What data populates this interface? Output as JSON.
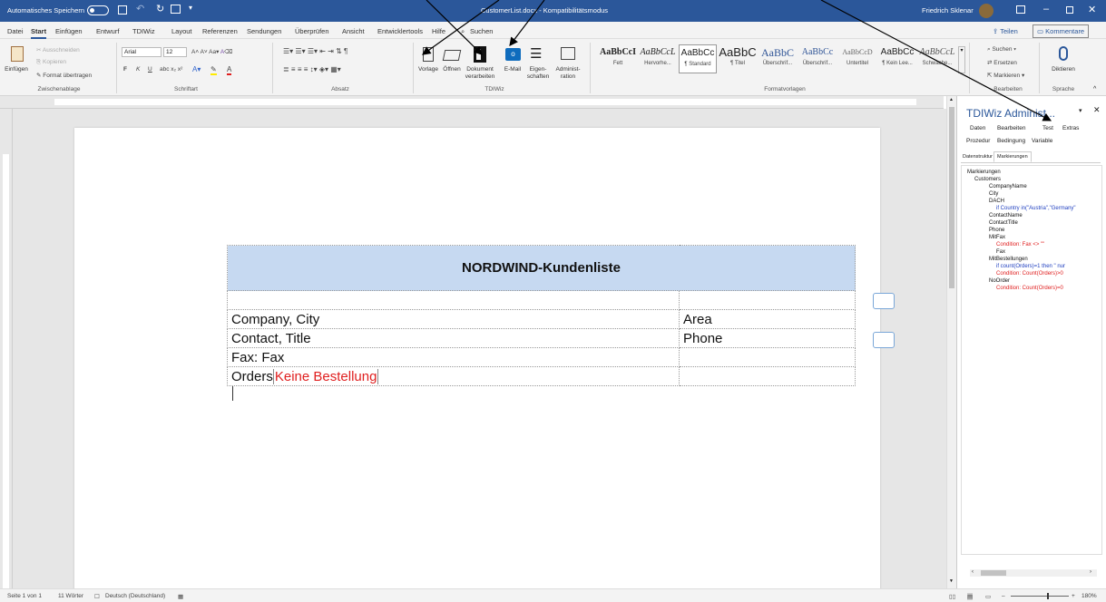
{
  "title_bar": {
    "autosave_label": "Automatisches Speichern",
    "document_title": "CustomerList.docx - Kompatibilitätsmodus",
    "search": "Suchen",
    "user": "Friedrich Sklenar"
  },
  "menu": [
    "Datei",
    "Start",
    "Einfügen",
    "Entwurf",
    "TDIWiz",
    "Layout",
    "Referenzen",
    "Sendungen",
    "Überprüfen",
    "Ansicht",
    "Entwicklertools",
    "Hilfe"
  ],
  "share_label": "Teilen",
  "comments_label": "Kommentare",
  "clipboard": {
    "paste": "Einfügen",
    "cut": "Ausschneiden",
    "copy": "Kopieren",
    "format_painter": "Format übertragen",
    "group": "Zwischenablage"
  },
  "font": {
    "name": "Arial",
    "size": "12",
    "group": "Schriftart",
    "bold": "F",
    "italic": "K",
    "underline": "U"
  },
  "paragraph_group": "Absatz",
  "tdiwiz": {
    "buttons": [
      {
        "label": "Vorlage",
        "icon": "template-icon"
      },
      {
        "label": "Öffnen",
        "icon": "folder-open-icon"
      },
      {
        "label": "Dokument verarbeiten",
        "icon": "process-document-icon"
      },
      {
        "label": "E-Mail",
        "icon": "outlook-mail-icon"
      },
      {
        "label": "Eigen-schaften",
        "icon": "properties-icon"
      },
      {
        "label": "Administ-ration",
        "icon": "administration-icon"
      }
    ],
    "group": "TDIWiz"
  },
  "styles": {
    "items": [
      {
        "preview": "AaBbCcI",
        "name": "Fett"
      },
      {
        "preview": "AaBbCcL",
        "name": "Hervorhe..."
      },
      {
        "preview": "AaBbCc",
        "name": "¶ Standard"
      },
      {
        "preview": "AaBbC",
        "name": "¶ Titel"
      },
      {
        "preview": "AaBbC",
        "name": "Überschrif..."
      },
      {
        "preview": "AaBbCc",
        "name": "Überschrif..."
      },
      {
        "preview": "AaBbCcD",
        "name": "Untertitel"
      },
      {
        "preview": "AaBbCc",
        "name": "¶ Kein Lee..."
      },
      {
        "preview": "AaBbCcL",
        "name": "Schwache..."
      }
    ],
    "group": "Formatvorlagen"
  },
  "editing": {
    "find": "Suchen",
    "replace": "Ersetzen",
    "select": "Markieren",
    "group": "Bearbeiten"
  },
  "voice": {
    "dictate": "Diktieren",
    "group": "Sprache"
  },
  "document": {
    "header": "NORDWIND-Kundenliste",
    "rows": [
      [
        "",
        ""
      ],
      [
        "Company, City",
        "Area"
      ],
      [
        "Contact, Title",
        "Phone"
      ],
      [
        "Fax: Fax",
        ""
      ],
      [
        "Orders",
        ""
      ]
    ],
    "no_order_text": "Keine Bestellung"
  },
  "pane": {
    "title": "TDIWiz Administ...",
    "menu": [
      "Daten",
      "Bearbeiten",
      "Test",
      "Extras"
    ],
    "submenu": [
      "Prozedur",
      "Bedingung",
      "Variable"
    ],
    "tabs": [
      "Datenstruktur",
      "Markierungen"
    ],
    "tree": [
      {
        "text": "Markierungen",
        "level": 0,
        "color": "black"
      },
      {
        "text": "Customers",
        "level": 1,
        "color": "black"
      },
      {
        "text": "CompanyName",
        "level": 2,
        "color": "black"
      },
      {
        "text": "City",
        "level": 2,
        "color": "black"
      },
      {
        "text": "DACH",
        "level": 2,
        "color": "black"
      },
      {
        "text": "if Country in(\"Austria\",\"Germany\"",
        "level": 3,
        "color": "blue"
      },
      {
        "text": "ContactName",
        "level": 2,
        "color": "black"
      },
      {
        "text": "ContactTitle",
        "level": 2,
        "color": "black"
      },
      {
        "text": "Phone",
        "level": 2,
        "color": "black"
      },
      {
        "text": "MitFax",
        "level": 2,
        "color": "black"
      },
      {
        "text": "Condition: Fax <> \"\"",
        "level": 3,
        "color": "red"
      },
      {
        "text": "Fax",
        "level": 3,
        "color": "black"
      },
      {
        "text": "MitBestellungen",
        "level": 2,
        "color": "black"
      },
      {
        "text": "if count(Orders)=1 then     \" nur",
        "level": 3,
        "color": "blue"
      },
      {
        "text": "Condition: Count(Orders)>0",
        "level": 3,
        "color": "red"
      },
      {
        "text": "NoOrder",
        "level": 2,
        "color": "black"
      },
      {
        "text": "Condition: Count(Orders)=0",
        "level": 3,
        "color": "red"
      }
    ]
  },
  "status": {
    "page": "Seite 1 von 1",
    "words": "11 Wörter",
    "language": "Deutsch (Deutschland)",
    "zoom": "180%"
  }
}
